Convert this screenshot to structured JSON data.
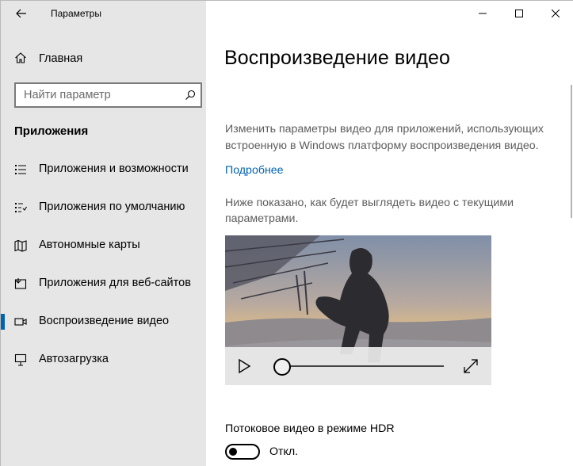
{
  "app": {
    "title": "Параметры"
  },
  "sidebar": {
    "home_label": "Главная",
    "search_placeholder": "Найти параметр",
    "section_title": "Приложения",
    "items": [
      {
        "label": "Приложения и возможности",
        "icon": "apps-list-icon",
        "active": false
      },
      {
        "label": "Приложения по умолчанию",
        "icon": "default-apps-icon",
        "active": false
      },
      {
        "label": "Автономные карты",
        "icon": "map-icon",
        "active": false
      },
      {
        "label": "Приложения для веб-сайтов",
        "icon": "web-apps-icon",
        "active": false
      },
      {
        "label": "Воспроизведение видео",
        "icon": "video-icon",
        "active": true
      },
      {
        "label": "Автозагрузка",
        "icon": "startup-icon",
        "active": false
      }
    ]
  },
  "main": {
    "title": "Воспроизведение видео",
    "description": "Изменить параметры видео для приложений, использующих встроенную в Windows платформу воспроизведения видео.",
    "more_link": "Подробнее",
    "preview_text": "Ниже показано, как будет выглядеть видео с текущими параметрами.",
    "hdr_label": "Потоковое видео в режиме HDR",
    "hdr_toggle_state": "Откл.",
    "hdr_enabled": false,
    "video_progress": 0
  },
  "colors": {
    "accent": "#0063b1",
    "sidebar_bg": "#e6e6e6",
    "secondary_text": "#5d5d5d"
  }
}
